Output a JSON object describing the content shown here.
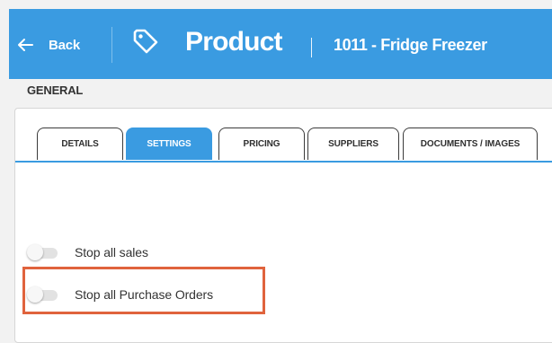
{
  "header": {
    "back_label": "Back",
    "title": "Product",
    "record_name": "1011 - Fridge Freezer",
    "color": "#3a9be1",
    "back_icon": "arrow-left-icon",
    "title_icon": "tag-icon"
  },
  "tabs": [
    {
      "label": "DETAILS",
      "active": false
    },
    {
      "label": "SETTINGS",
      "active": true
    },
    {
      "label": "PRICING",
      "active": false
    },
    {
      "label": "SUPPLIERS",
      "active": false
    },
    {
      "label": "DOCUMENTS / IMAGES",
      "active": false
    }
  ],
  "section": {
    "heading": "GENERAL",
    "toggles": [
      {
        "label": "Stop all sales",
        "on": false
      },
      {
        "label": "Stop all Purchase Orders",
        "on": false
      }
    ]
  },
  "highlight_color": "#e0633d"
}
